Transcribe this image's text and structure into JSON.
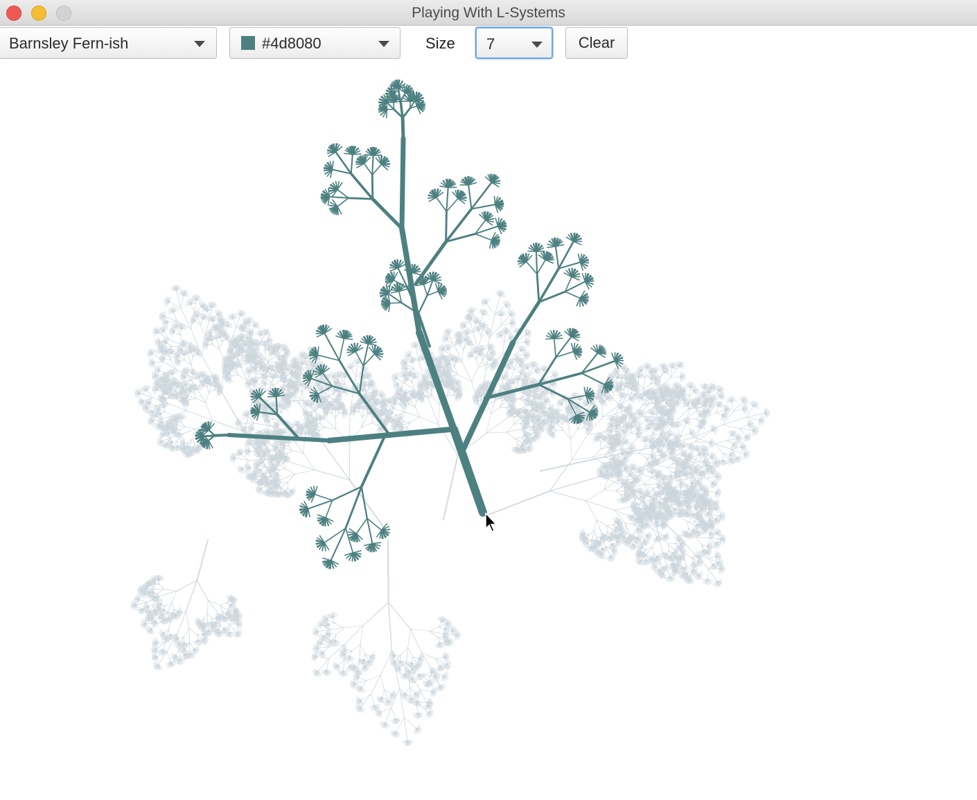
{
  "window": {
    "title": "Playing With L-Systems"
  },
  "toolbar": {
    "system_select": {
      "value": "Barnsley Fern-ish"
    },
    "color_select": {
      "value": "#4d8080",
      "swatch_color": "#4d8080"
    },
    "size_label": "Size",
    "size_select": {
      "value": "7"
    },
    "clear_label": "Clear"
  },
  "canvas": {
    "stroke_color": "#4d8080",
    "ghost_color": "#ccd6dc"
  }
}
